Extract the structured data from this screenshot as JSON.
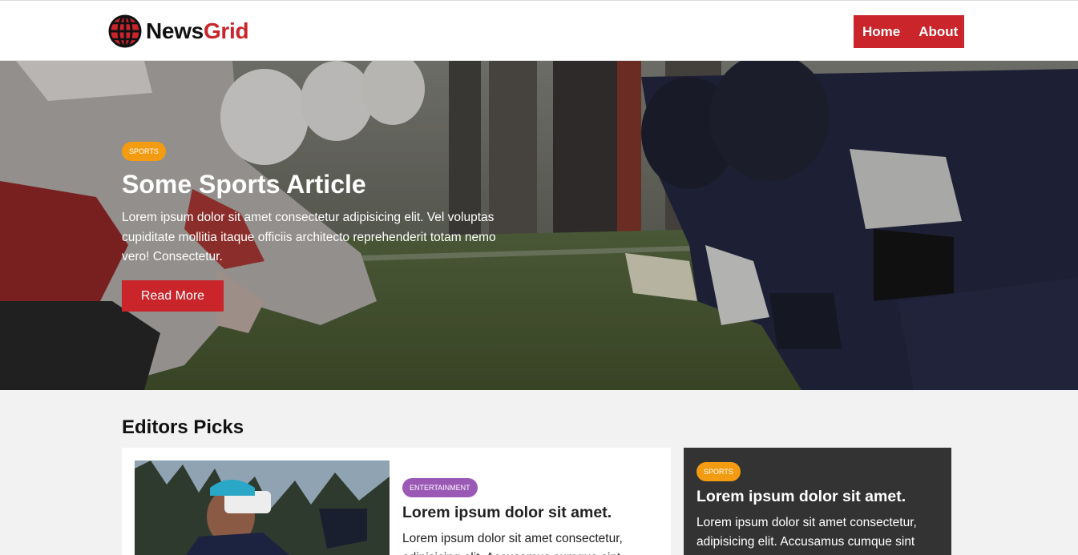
{
  "header": {
    "logo": {
      "part1": "News",
      "part2": "Grid"
    },
    "nav": [
      {
        "label": "Home"
      },
      {
        "label": "About"
      }
    ]
  },
  "hero": {
    "category": "SPORTS",
    "title": "Some Sports Article",
    "text": "Lorem ipsum dolor sit amet consectetur adipisicing elit. Vel voluptas cupiditate mollitia itaque officiis architecto reprehenderit totam nemo vero! Consectetur.",
    "button": "Read More",
    "image": "football-linemen-photo"
  },
  "editors_picks": {
    "title": "Editors Picks",
    "main_card": {
      "category": "ENTERTAINMENT",
      "title": "Lorem ipsum dolor sit amet.",
      "text": "Lorem ipsum dolor sit amet consectetur, adipisicing elit. Accusamus cumque sint",
      "image": "vr-headset-man-photo"
    },
    "side_card": {
      "category": "SPORTS",
      "title": "Lorem ipsum dolor sit amet.",
      "text": "Lorem ipsum dolor sit amet consectetur, adipisicing elit. Accusamus cumque sint"
    }
  },
  "colors": {
    "brand_red": "#c9252b",
    "sports_badge": "#f39c12",
    "entertainment_badge": "#9b59b6",
    "dark_card": "#333333"
  }
}
